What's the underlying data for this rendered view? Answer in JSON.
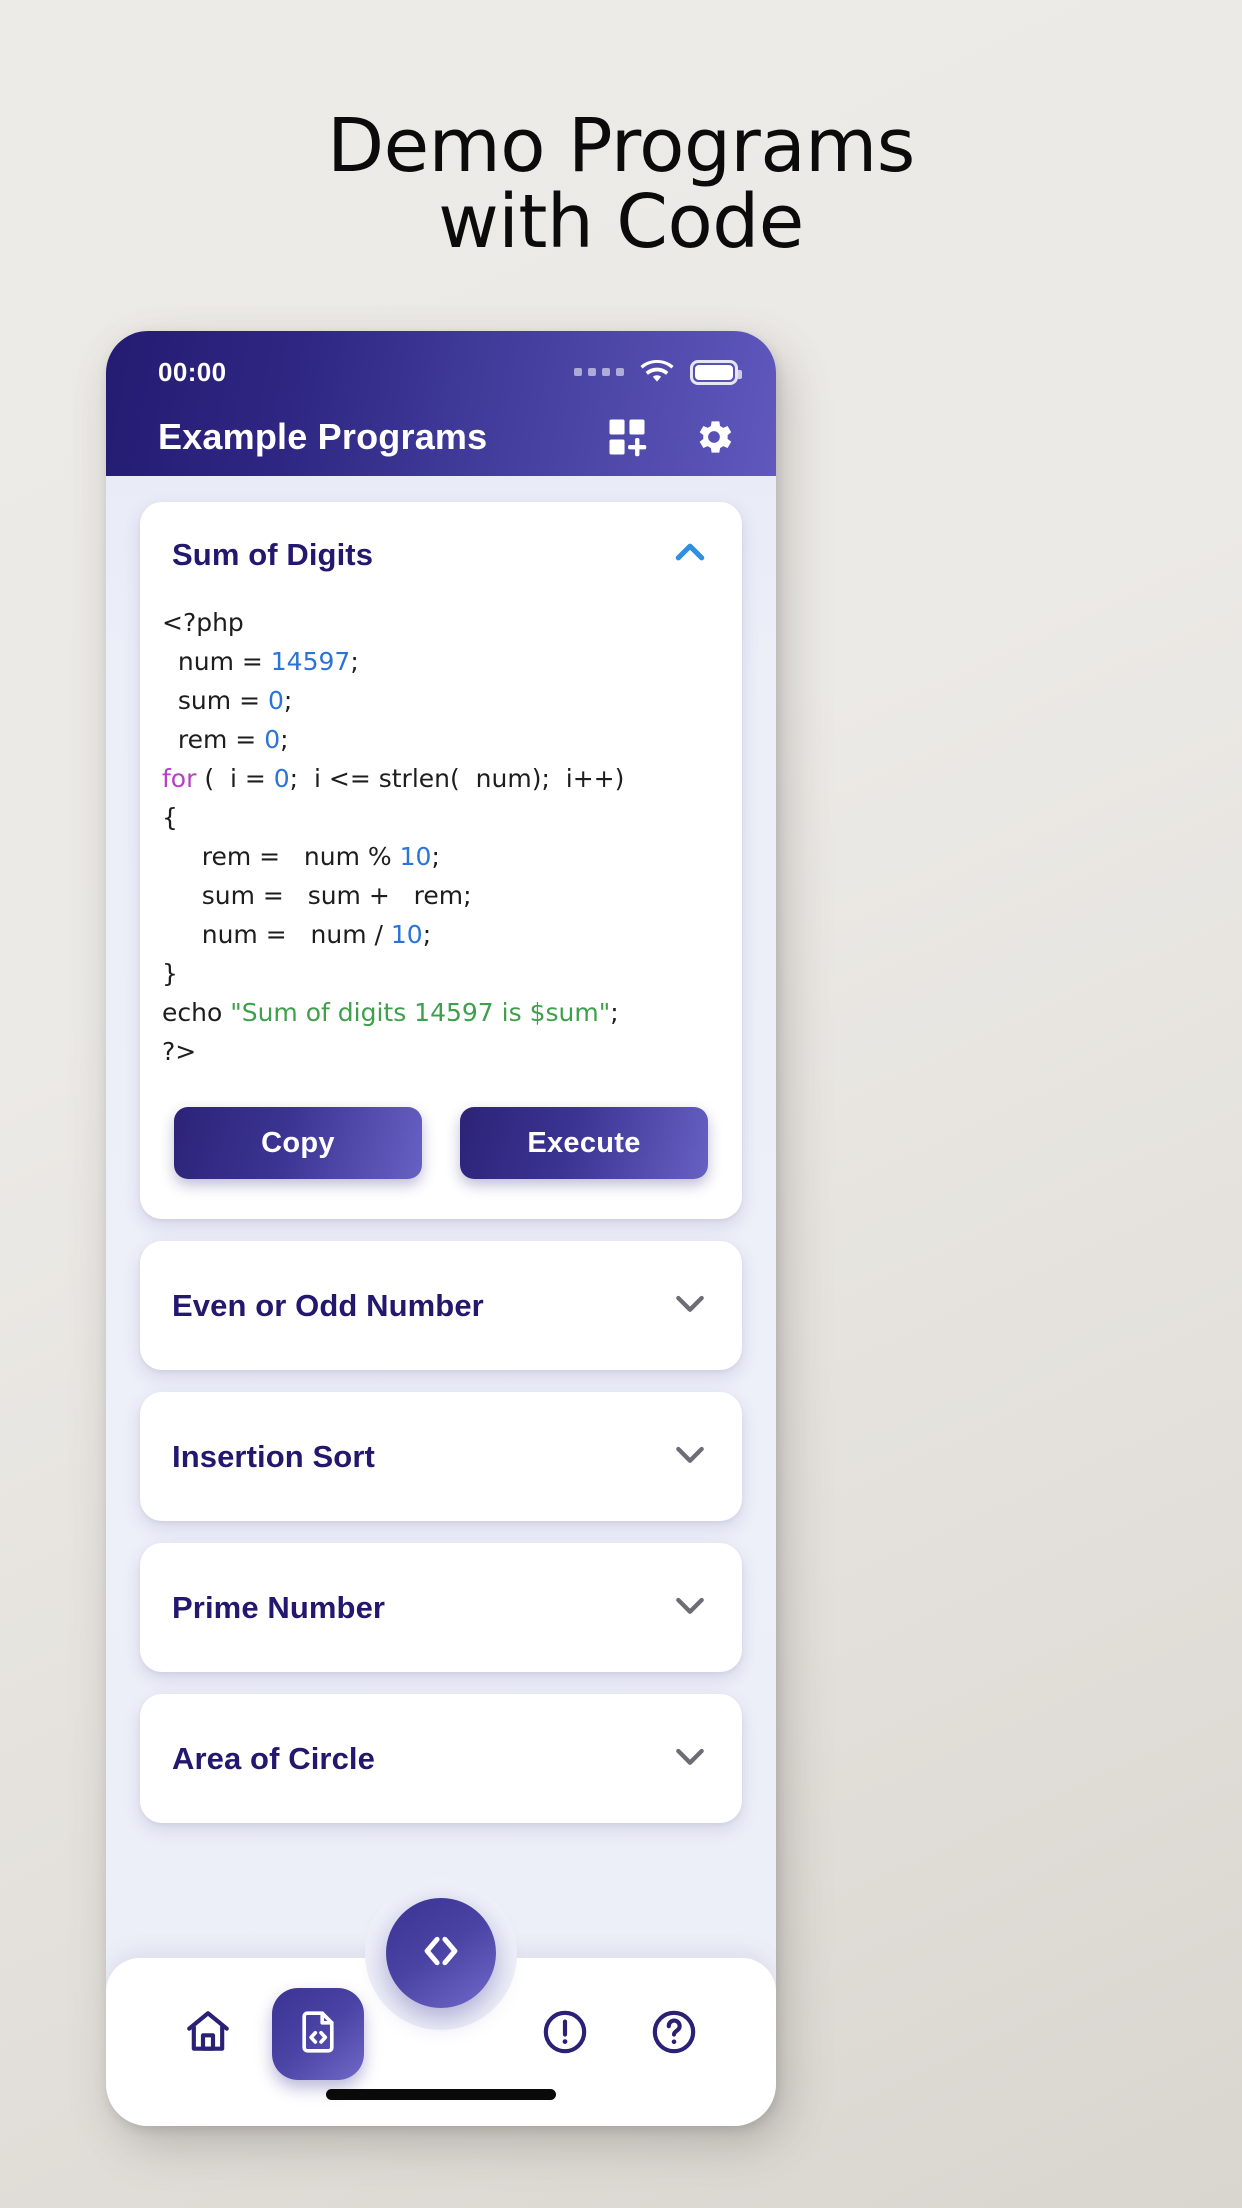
{
  "poster": {
    "line1": "Demo Programs",
    "line2": "with Code"
  },
  "colors": {
    "appbar_dark": "#241c72",
    "appbar_light": "#6058bd",
    "card_title": "#24176e",
    "accent_chevron_open": "#2f8fe0",
    "chevron_closed": "#6d6d75",
    "code_number": "#2a74d6",
    "code_keyword": "#b63fc4",
    "code_string": "#3fa04b",
    "page_bg": "#eceef8"
  },
  "statusbar": {
    "time": "00:00",
    "signal_icon": "signal-dots-icon",
    "wifi_icon": "wifi-icon",
    "battery_icon": "battery-full-icon"
  },
  "appbar": {
    "title": "Example Programs",
    "actions": [
      {
        "name": "add-grid-icon",
        "label": "Add"
      },
      {
        "name": "gear-icon",
        "label": "Settings"
      }
    ]
  },
  "programs": [
    {
      "title": "Sum of Digits",
      "expanded": true,
      "chevron": "chevron-up-icon",
      "code_lines": [
        [
          {
            "t": "<?php",
            "c": "plain"
          }
        ],
        [
          {
            "t": "  num = ",
            "c": "plain"
          },
          {
            "t": "14597",
            "c": "num"
          },
          {
            "t": ";",
            "c": "plain"
          }
        ],
        [
          {
            "t": "  sum = ",
            "c": "plain"
          },
          {
            "t": "0",
            "c": "num"
          },
          {
            "t": ";",
            "c": "plain"
          }
        ],
        [
          {
            "t": "  rem = ",
            "c": "plain"
          },
          {
            "t": "0",
            "c": "num"
          },
          {
            "t": ";",
            "c": "plain"
          }
        ],
        [
          {
            "t": "for",
            "c": "kw"
          },
          {
            "t": " (  i = ",
            "c": "plain"
          },
          {
            "t": "0",
            "c": "num"
          },
          {
            "t": ";  i <= strlen(  num);  i++)",
            "c": "plain"
          }
        ],
        [
          {
            "t": "{",
            "c": "plain"
          }
        ],
        [
          {
            "t": "     rem =   num % ",
            "c": "plain"
          },
          {
            "t": "10",
            "c": "num"
          },
          {
            "t": ";",
            "c": "plain"
          }
        ],
        [
          {
            "t": "     sum =   sum +   rem;",
            "c": "plain"
          }
        ],
        [
          {
            "t": "     num =   num / ",
            "c": "plain"
          },
          {
            "t": "10",
            "c": "num"
          },
          {
            "t": ";",
            "c": "plain"
          }
        ],
        [
          {
            "t": "}",
            "c": "plain"
          }
        ],
        [
          {
            "t": "echo ",
            "c": "plain"
          },
          {
            "t": "\"Sum of digits 14597 is $sum\"",
            "c": "str"
          },
          {
            "t": ";",
            "c": "plain"
          }
        ],
        [
          {
            "t": "?>",
            "c": "plain"
          }
        ]
      ],
      "buttons": [
        {
          "name": "copy-button",
          "label": "Copy"
        },
        {
          "name": "execute-button",
          "label": "Execute"
        }
      ]
    },
    {
      "title": "Even or Odd Number",
      "expanded": false,
      "chevron": "chevron-down-icon"
    },
    {
      "title": "Insertion Sort",
      "expanded": false,
      "chevron": "chevron-down-icon"
    },
    {
      "title": "Prime Number",
      "expanded": false,
      "chevron": "chevron-down-icon"
    },
    {
      "title": "Area of Circle",
      "expanded": false,
      "chevron": "chevron-down-icon"
    }
  ],
  "bottom_nav": {
    "items": [
      {
        "name": "nav-home",
        "icon": "home-icon",
        "active": false
      },
      {
        "name": "nav-code-file",
        "icon": "file-code-icon",
        "active": true
      },
      {
        "name": "nav-info",
        "icon": "exclamation-circle-icon",
        "active": false
      },
      {
        "name": "nav-help",
        "icon": "question-circle-icon",
        "active": false
      }
    ],
    "fab": {
      "name": "code-fab",
      "icon": "angle-brackets-icon"
    }
  }
}
